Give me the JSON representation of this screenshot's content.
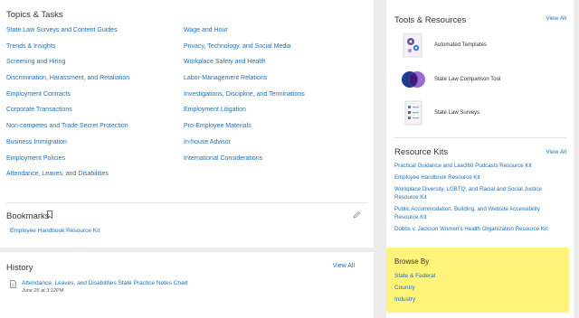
{
  "topics": {
    "title": "Topics & Tasks",
    "col1": [
      "State Law Surveys and Content Guides",
      "Trends & Insights",
      "Screening and Hiring",
      "Discrimination, Harassment, and Retaliation",
      "Employment Contracts",
      "Corporate Transactions",
      "Non-competes and Trade Secret Protection",
      "Business Immigration",
      "Employment Policies",
      "Attendance, Leaves, and Disabilities"
    ],
    "col2": [
      "Wage and Hour",
      "Privacy, Technology, and Social Media",
      "Workplace Safety and Health",
      "Labor-Management Relations",
      "Investigations, Discipline, and Terminations",
      "Employment Litigation",
      "Pro-Employee Materials",
      "In-house Advisor",
      "International Considerations"
    ]
  },
  "bookmarks": {
    "title": "Bookmarks",
    "items": [
      "Employee Handbook Resource Kit"
    ]
  },
  "history": {
    "title": "History",
    "view_all": "View All",
    "items": [
      {
        "title": "Attendance, Leaves, and Disabilities State Practice Notes Chart",
        "date": "June 26 at 3:12PM"
      }
    ]
  },
  "tools": {
    "title": "Tools & Resources",
    "view_all": "View All",
    "items": [
      {
        "label": "Automated Templates",
        "icon": "gears-icon"
      },
      {
        "label": "State Law Comparison Tool",
        "icon": "compare-circles-icon"
      },
      {
        "label": "State Law Surveys",
        "icon": "survey-document-icon"
      }
    ]
  },
  "resource_kits": {
    "title": "Resource Kits",
    "view_all": "View All",
    "items": [
      "Practical Guidance and Law360 Podcasts Resource Kit",
      "Employee Handbook Resource Kit",
      "Workplace Diversity, LGBTQ, and Racial and Social Justice Resource Kit",
      "Public Accommodation, Building, and Website Accessibility Resource Kit",
      "Dobbs v. Jackson Women's Health Organization Resource Kit"
    ]
  },
  "browse_by": {
    "title": "Browse By",
    "items": [
      "State & Federal",
      "Country",
      "Industry"
    ]
  },
  "colors": {
    "link": "#1f6fb5",
    "highlight": "#fff37a",
    "background": "#ececec"
  }
}
